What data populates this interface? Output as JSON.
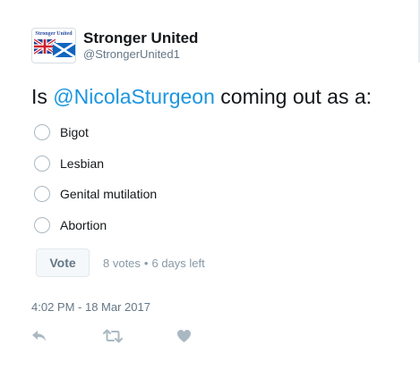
{
  "account": {
    "display_name": "Stronger United",
    "handle": "@StrongerUnited1",
    "avatar_text": "Stronger United"
  },
  "tweet": {
    "text_before": "Is ",
    "mention": "@NicolaSturgeon",
    "text_after": " coming out as a:"
  },
  "poll": {
    "options": [
      "Bigot",
      "Lesbian",
      "Genital mutilation",
      "Abortion"
    ],
    "vote_label": "Vote",
    "votes": "8 votes",
    "separator": "•",
    "time_left": "6 days left"
  },
  "timestamp": "4:02 PM - 18 Mar 2017",
  "actions": {
    "icons": [
      "reply-icon",
      "retweet-icon",
      "like-icon"
    ]
  },
  "colors": {
    "mention": "#1b95e0",
    "secondary_text": "#657786",
    "action_icon": "#aab8c2",
    "vote_button_bg": "#f5f8fa"
  }
}
